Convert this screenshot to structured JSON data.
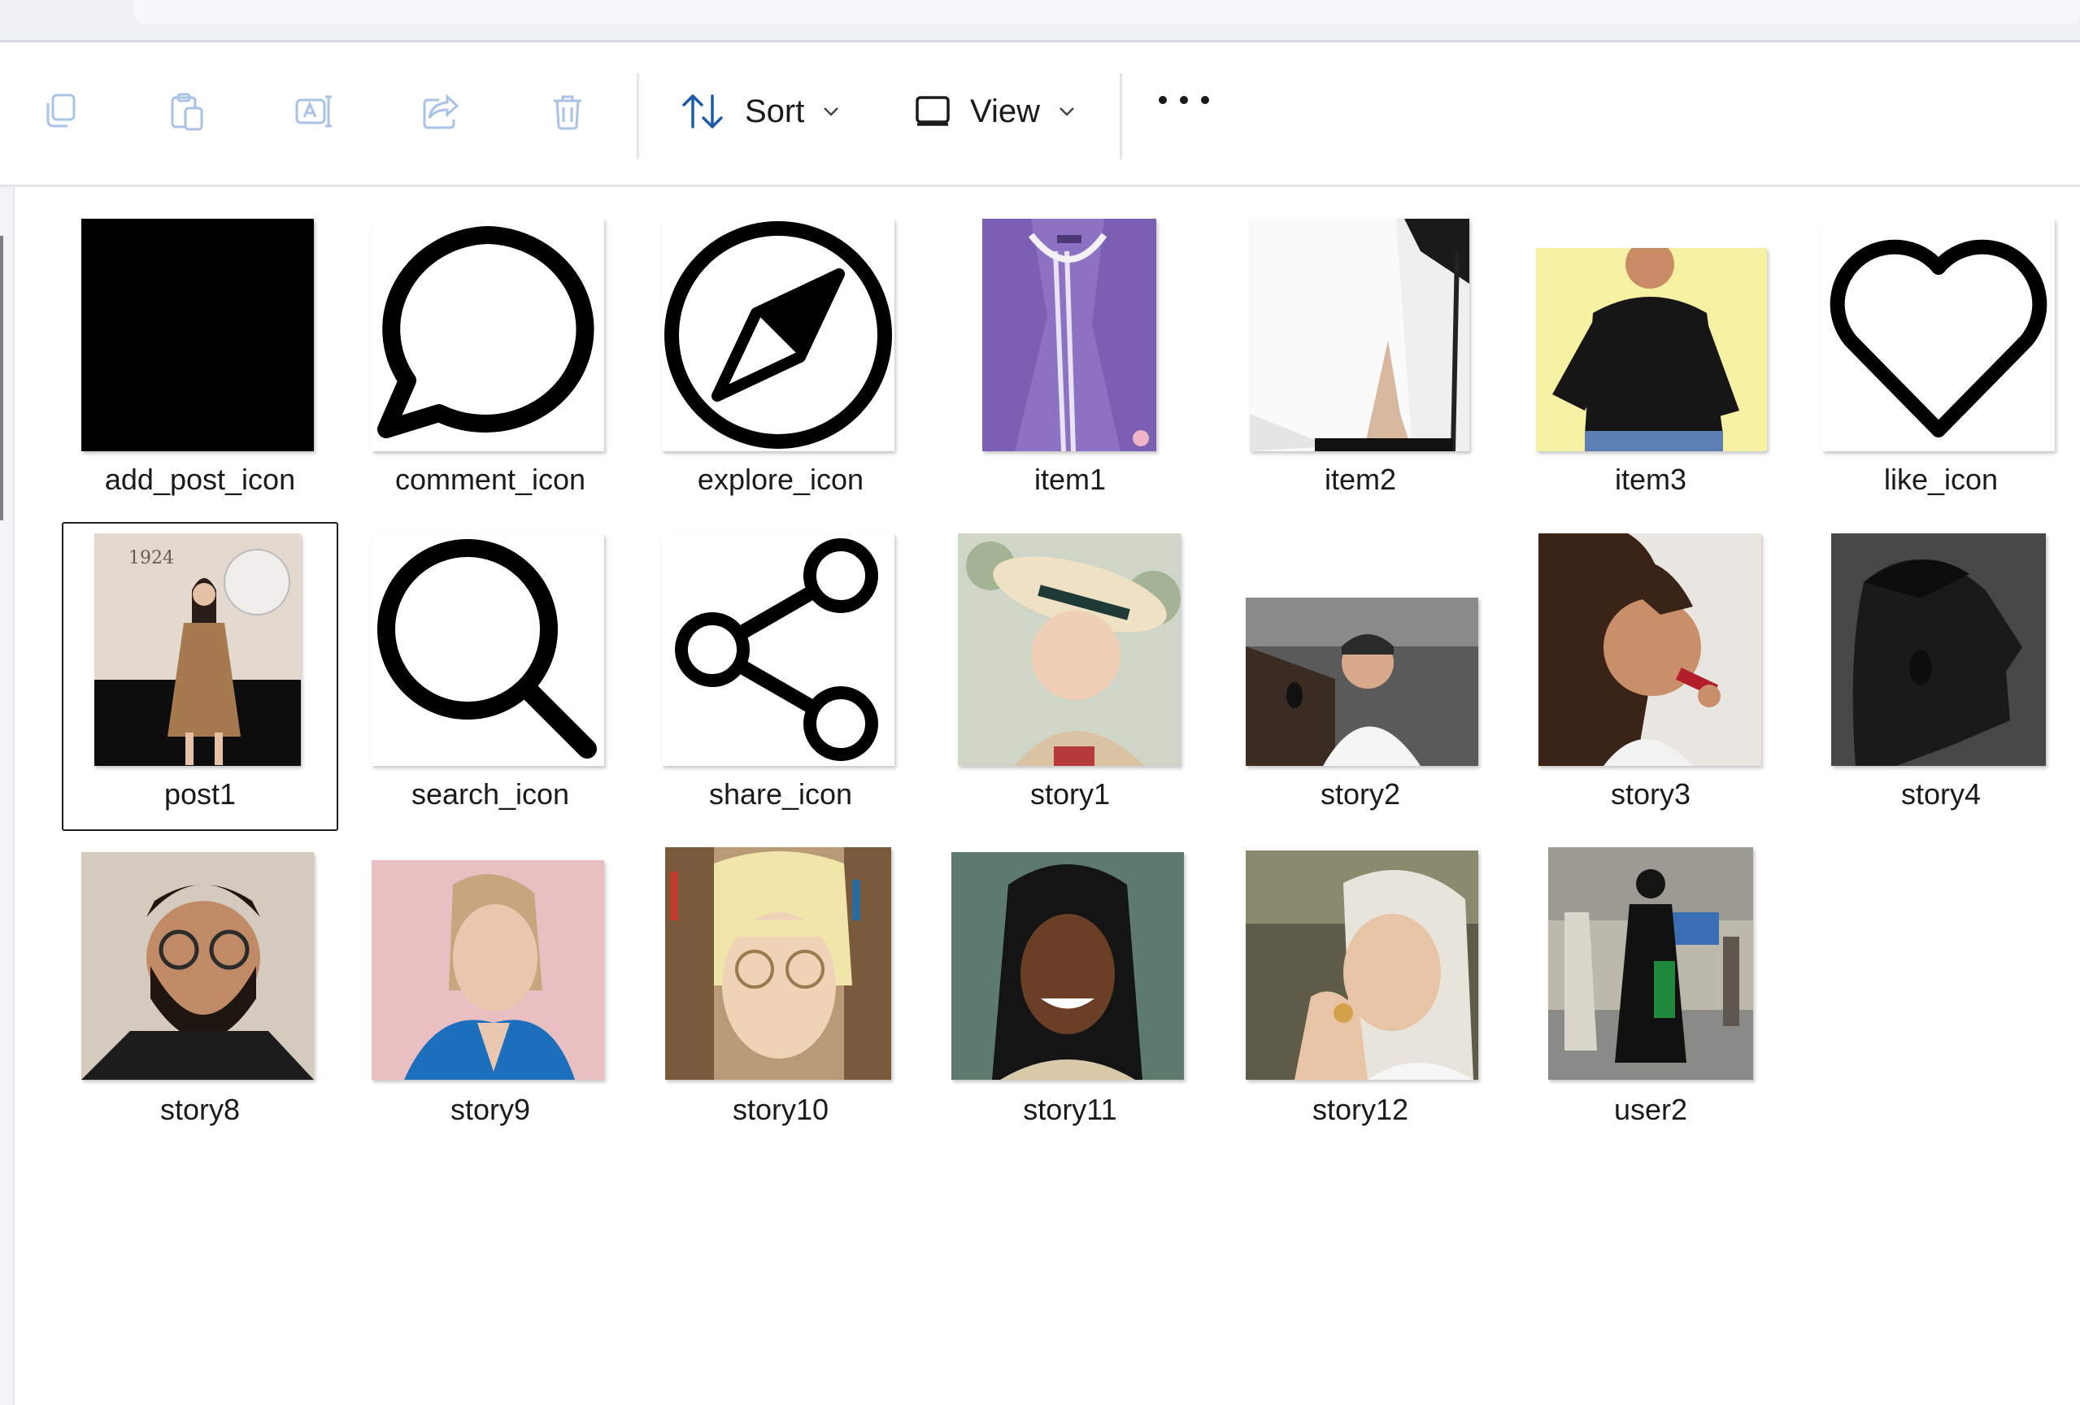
{
  "toolbar": {
    "sort_label": "Sort",
    "view_label": "View",
    "buttons": [
      "copy-icon",
      "paste-icon",
      "rename-icon",
      "share-icon",
      "delete-icon",
      "sort-icon",
      "view-icon",
      "more-icon"
    ]
  },
  "files": [
    {
      "name": "add_post_icon"
    },
    {
      "name": "comment_icon"
    },
    {
      "name": "explore_icon"
    },
    {
      "name": "item1"
    },
    {
      "name": "item2"
    },
    {
      "name": "item3"
    },
    {
      "name": "like_icon"
    },
    {
      "name": "post1",
      "selected": true,
      "thumb_text": "1924"
    },
    {
      "name": "search_icon"
    },
    {
      "name": "share_icon"
    },
    {
      "name": "story1"
    },
    {
      "name": "story2"
    },
    {
      "name": "story3"
    },
    {
      "name": "story4"
    },
    {
      "name": "story8"
    },
    {
      "name": "story9"
    },
    {
      "name": "story10"
    },
    {
      "name": "story11"
    },
    {
      "name": "story12"
    },
    {
      "name": "user2"
    }
  ]
}
